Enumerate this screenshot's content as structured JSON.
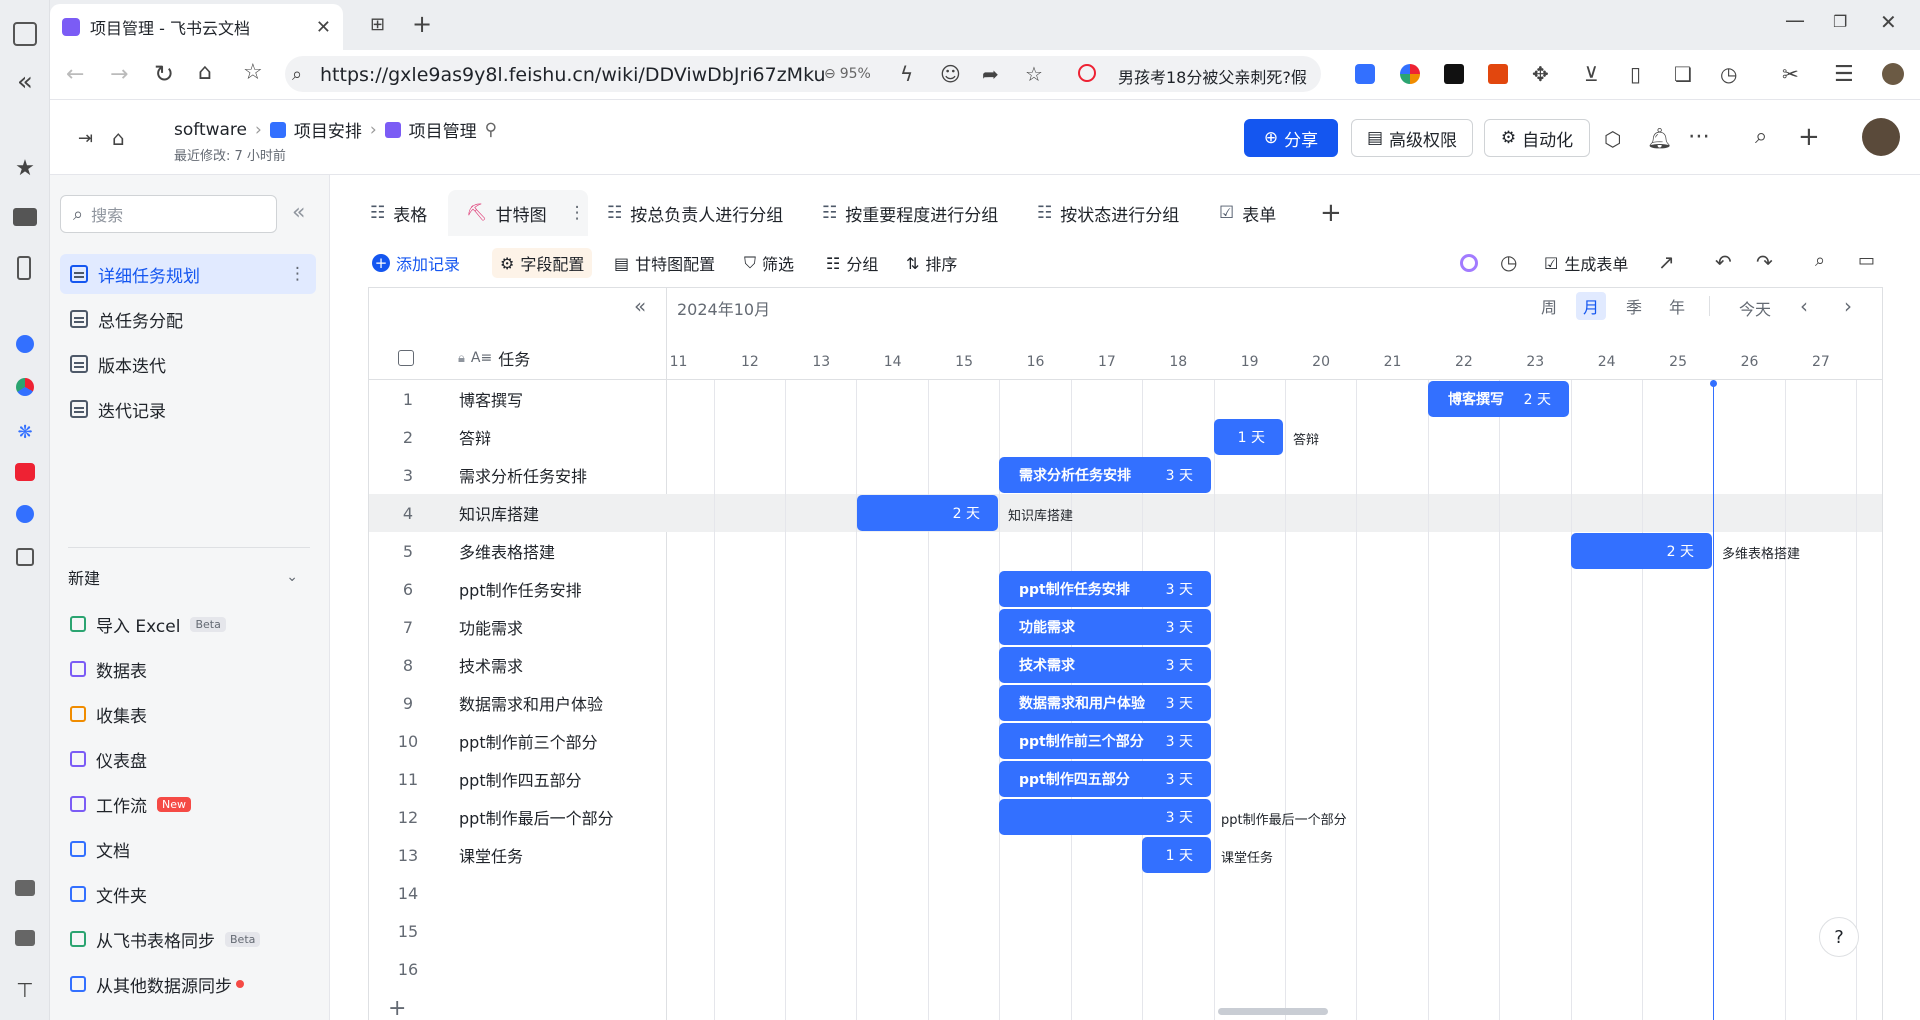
{
  "browser": {
    "tab_title": "项目管理 - 飞书云文档",
    "url": "https://gxle9as9y8l.feishu.cn/wiki/DDViwDbJri67zMku",
    "zoom": "95%",
    "news": "男孩考18分被父亲刺死?假"
  },
  "header": {
    "breadcrumb": [
      "software",
      "项目安排",
      "项目管理"
    ],
    "last_modified": "最近修改: 7 小时前",
    "share_label": "分享",
    "perm_label": "高级权限",
    "auto_label": "自动化"
  },
  "sidebar": {
    "search_placeholder": "搜索",
    "tables": [
      {
        "label": "详细任务规划",
        "active": true
      },
      {
        "label": "总任务分配"
      },
      {
        "label": "版本迭代"
      },
      {
        "label": "迭代记录"
      }
    ],
    "new_label": "新建",
    "new_items": [
      {
        "label": "导入 Excel",
        "badge": "Beta",
        "color": "#2ba471"
      },
      {
        "label": "数据表",
        "color": "#7b5cf5"
      },
      {
        "label": "收集表",
        "color": "#f08c00"
      },
      {
        "label": "仪表盘",
        "color": "#7b5cf5"
      },
      {
        "label": "工作流",
        "badge": "New",
        "color": "#7b5cf5"
      },
      {
        "label": "文档",
        "color": "#3370ff"
      },
      {
        "label": "文件夹",
        "color": "#3370ff"
      },
      {
        "label": "从飞书表格同步",
        "badge": "Beta",
        "color": "#2ba471"
      },
      {
        "label": "从其他数据源同步",
        "color": "#3370ff"
      }
    ]
  },
  "views": [
    "表格",
    "甘特图",
    "按总负责人进行分组",
    "按重要程度进行分组",
    "按状态进行分组",
    "表单"
  ],
  "toolbar": {
    "add": "添加记录",
    "fields": "字段配置",
    "gantt_cfg": "甘特图配置",
    "filter": "筛选",
    "group": "分组",
    "sort": "排序",
    "gen_form": "生成表单"
  },
  "gantt": {
    "month": "2024年10月",
    "scales": [
      "周",
      "月",
      "季",
      "年"
    ],
    "active_scale": "月",
    "today": "今天",
    "column_header": "任务",
    "days": [
      11,
      12,
      13,
      14,
      15,
      16,
      17,
      18,
      19,
      20,
      21,
      22,
      23,
      24,
      25,
      26,
      27
    ],
    "rows": [
      {
        "n": "1",
        "task": "博客撰写",
        "start": 22,
        "dur": 2,
        "label": "2 天",
        "inbar": "博客撰写"
      },
      {
        "n": "2",
        "task": "答辩",
        "start": 19,
        "dur": 1,
        "label": "1 天",
        "after": "答辩"
      },
      {
        "n": "3",
        "task": "需求分析任务安排",
        "start": 16,
        "dur": 3,
        "label": "3 天",
        "inbar": "需求分析任务安排"
      },
      {
        "n": "4",
        "task": "知识库搭建",
        "start": 14,
        "dur": 2,
        "label": "2 天",
        "after": "知识库搭建"
      },
      {
        "n": "5",
        "task": "多维表格搭建",
        "start": 24,
        "dur": 2,
        "label": "2 天",
        "after": "多维表格搭建"
      },
      {
        "n": "6",
        "task": "ppt制作任务安排",
        "start": 16,
        "dur": 3,
        "label": "3 天",
        "inbar": "ppt制作任务安排"
      },
      {
        "n": "7",
        "task": "功能需求",
        "start": 16,
        "dur": 3,
        "label": "3 天",
        "inbar": "功能需求"
      },
      {
        "n": "8",
        "task": "技术需求",
        "start": 16,
        "dur": 3,
        "label": "3 天",
        "inbar": "技术需求"
      },
      {
        "n": "9",
        "task": "数据需求和用户体验",
        "start": 16,
        "dur": 3,
        "label": "3 天",
        "inbar": "数据需求和用户体验"
      },
      {
        "n": "10",
        "task": "ppt制作前三个部分",
        "start": 16,
        "dur": 3,
        "label": "3 天",
        "inbar": "ppt制作前三个部分"
      },
      {
        "n": "11",
        "task": "ppt制作四五部分",
        "start": 16,
        "dur": 3,
        "label": "3 天",
        "inbar": "ppt制作四五部分"
      },
      {
        "n": "12",
        "task": "ppt制作最后一个部分",
        "start": 16,
        "dur": 3,
        "label": "3 天",
        "after": "ppt制作最后一个部分"
      },
      {
        "n": "13",
        "task": "课堂任务",
        "start": 18,
        "dur": 1,
        "label": "1 天",
        "after": "课堂任务"
      },
      {
        "n": "14",
        "task": ""
      },
      {
        "n": "15",
        "task": ""
      },
      {
        "n": "16",
        "task": ""
      }
    ]
  }
}
